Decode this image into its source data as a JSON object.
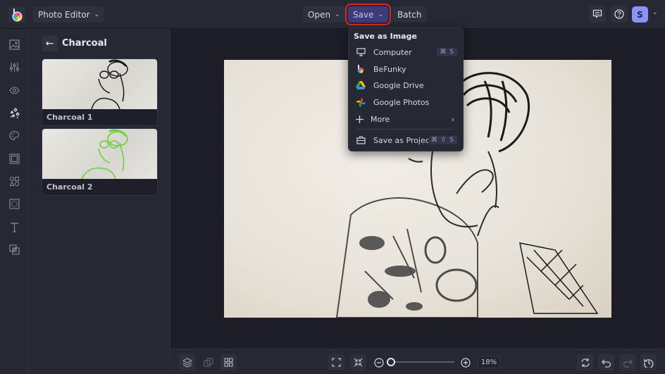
{
  "topbar": {
    "app_menu_label": "Photo Editor",
    "open_label": "Open",
    "save_label": "Save",
    "batch_label": "Batch",
    "avatar_initial": "S"
  },
  "rail": {
    "items": [
      {
        "name": "image-manager",
        "icon": "image-icon"
      },
      {
        "name": "edit",
        "icon": "sliders-icon"
      },
      {
        "name": "touch-up",
        "icon": "eye-icon"
      },
      {
        "name": "effects",
        "icon": "sparkles-icon",
        "active": true
      },
      {
        "name": "artsy",
        "icon": "palette-icon"
      },
      {
        "name": "frames",
        "icon": "frame-icon"
      },
      {
        "name": "graphics",
        "icon": "shapes-icon"
      },
      {
        "name": "overlays",
        "icon": "overlay-icon"
      },
      {
        "name": "text",
        "icon": "text-icon"
      },
      {
        "name": "textures",
        "icon": "layers-blend-icon"
      }
    ]
  },
  "panel": {
    "title": "Charcoal",
    "cards": [
      {
        "label": "Charcoal 1",
        "tint": "#1a1a1a"
      },
      {
        "label": "Charcoal 2",
        "tint": "#6fcf3a"
      }
    ]
  },
  "save_menu": {
    "heading": "Save as Image",
    "items": [
      {
        "label": "Computer",
        "shortcut": "⌘ S",
        "icon": "monitor-icon"
      },
      {
        "label": "BeFunky",
        "icon": "befunky-icon"
      },
      {
        "label": "Google Drive",
        "icon": "google-drive-icon"
      },
      {
        "label": "Google Photos",
        "icon": "google-photos-icon"
      },
      {
        "label": "More",
        "icon": "plus-icon",
        "submenu": true
      },
      {
        "label": "Save as Project",
        "shortcut": "⌘ ⇧ S",
        "icon": "briefcase-icon"
      }
    ]
  },
  "bottombar": {
    "zoom_percent": "18%",
    "zoom_slider_value": 0.18
  },
  "colors": {
    "accent": "#8c91f5",
    "save_highlight": "#e0271f",
    "save_bg": "#3d3b7a"
  }
}
